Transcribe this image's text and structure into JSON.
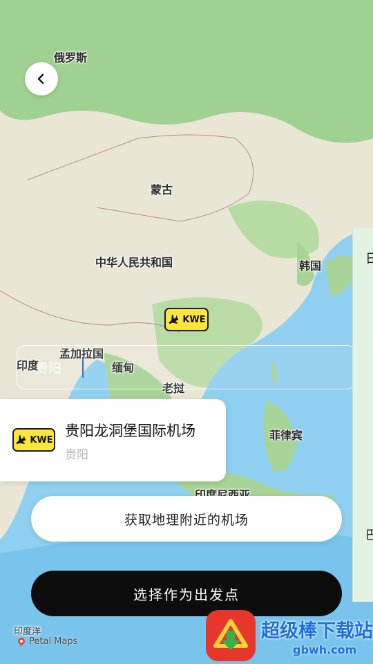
{
  "map": {
    "labels": {
      "russia": "俄罗斯",
      "mongolia": "蒙古",
      "china": "中华人民共和国",
      "korea": "韩国",
      "india": "印度",
      "bangladesh": "孟加拉国",
      "myanmar": "缅甸",
      "laos": "老挝",
      "philippines": "菲律宾",
      "indonesia": "印度尼西亚",
      "indian_ocean": "印度洋"
    },
    "attribution": "Petal Maps",
    "colors": {
      "land": "#eae6d6",
      "forest": "#a9d49a",
      "sea": "#8fd0f0",
      "deep_sea": "#5fb6e8"
    }
  },
  "back_button": {
    "icon": "chevron-left-icon"
  },
  "marker": {
    "code": "KWE",
    "icon": "airplane-icon"
  },
  "search": {
    "value": "贵阳"
  },
  "side_panel": {
    "top_char": "日",
    "bottom_char": "巴"
  },
  "result": {
    "code": "KWE",
    "name": "贵阳龙洞堡国际机场",
    "city": "贵阳"
  },
  "buttons": {
    "nearby": "获取地理附近的机场",
    "select": "选择作为出发点"
  },
  "watermark": {
    "text": "超级棒下载站",
    "url": "gbwh.com"
  },
  "accent": {
    "badge_yellow": "#fde63a",
    "primary_black": "#0d0d0d"
  }
}
